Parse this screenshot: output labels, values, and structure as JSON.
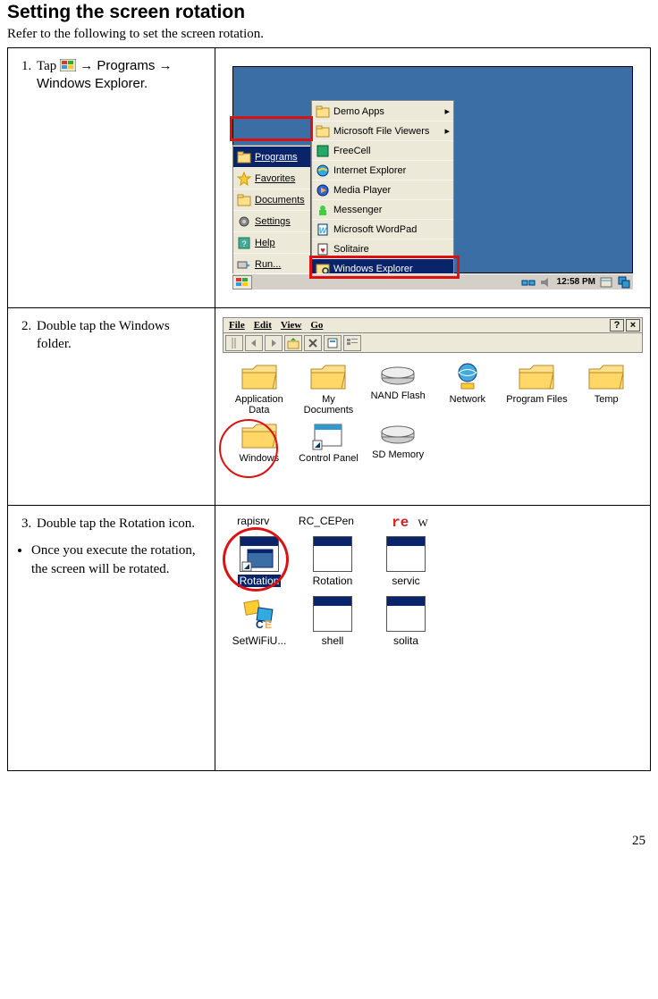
{
  "heading": "Setting the screen rotation",
  "intro": "Refer to the following to set the screen rotation.",
  "rows": [
    {
      "step_prefix": "Tap ",
      "step_suffix": " → Programs → Windows Explorer.",
      "start_menu": {
        "items": [
          {
            "label": "Programs",
            "underline": true,
            "highlighted": true
          },
          {
            "label": "Favorites",
            "underline": true
          },
          {
            "label": "Documents",
            "underline": true
          },
          {
            "label": "Settings",
            "underline": true
          },
          {
            "label": "Help",
            "underline": true
          },
          {
            "label": "Run...",
            "underline": true
          }
        ]
      },
      "programs_menu": {
        "items": [
          {
            "label": "Demo Apps",
            "sub": true
          },
          {
            "label": "Microsoft File Viewers",
            "sub": true
          },
          {
            "label": "FreeCell"
          },
          {
            "label": "Internet Explorer"
          },
          {
            "label": "Media Player"
          },
          {
            "label": "Messenger"
          },
          {
            "label": "Microsoft WordPad"
          },
          {
            "label": "Solitaire"
          },
          {
            "label": "Windows Explorer",
            "highlighted": true
          }
        ]
      },
      "taskbar": {
        "clock": "12:58 PM"
      }
    },
    {
      "step": "Double tap the Windows folder.",
      "menubar": [
        "File",
        "Edit",
        "View",
        "Go"
      ],
      "rbtns": [
        "?",
        "×"
      ],
      "folders": [
        {
          "label": "Application Data",
          "type": "folder"
        },
        {
          "label": "My Documents",
          "type": "folder"
        },
        {
          "label": "NAND Flash",
          "type": "drive"
        },
        {
          "label": "Network",
          "type": "network"
        },
        {
          "label": "Program Files",
          "type": "folder"
        },
        {
          "label": "Temp",
          "type": "folder"
        },
        {
          "label": "Windows",
          "type": "folder"
        },
        {
          "label": "Control Panel",
          "type": "shortcut"
        },
        {
          "label": "SD Memory",
          "type": "drive"
        }
      ]
    },
    {
      "step": "Double tap the Rotation icon.",
      "note": "Once you execute the rotation, the screen will be rotated.",
      "top_labels": [
        "rapisrv",
        "RC_CEPen",
        "re"
      ],
      "icons": [
        {
          "label": "Rotation",
          "selected": true
        },
        {
          "label": "Rotation"
        },
        {
          "label": "servic"
        },
        {
          "label": "SetWiFiU..."
        },
        {
          "label": "shell"
        },
        {
          "label": "solita"
        }
      ]
    }
  ],
  "page_number": "25"
}
